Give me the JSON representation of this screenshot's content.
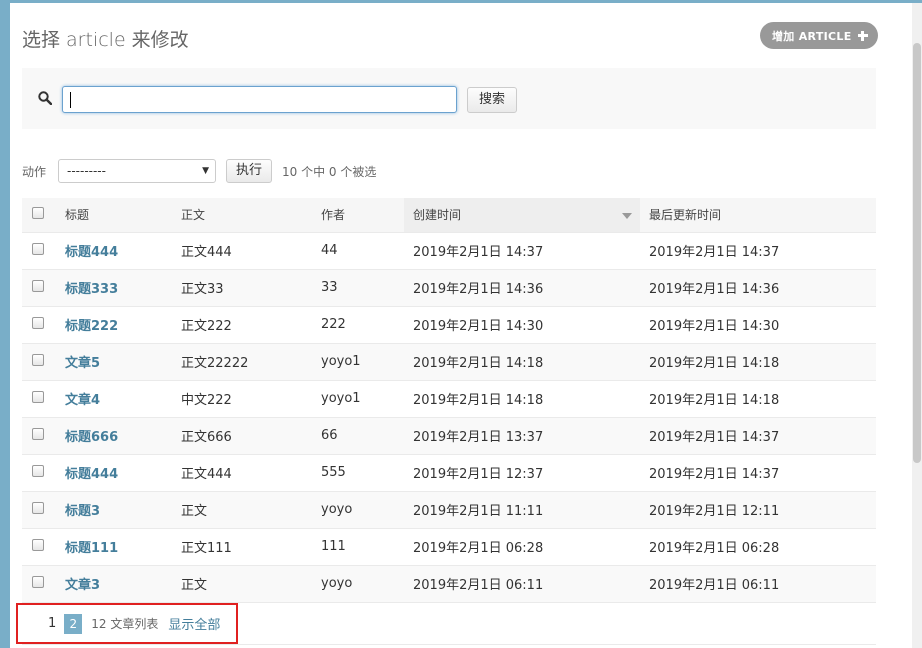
{
  "header": {
    "title": "选择 article 来修改",
    "add_button_label": "增加 ARTICLE"
  },
  "search": {
    "value": "",
    "button_label": "搜索"
  },
  "actions": {
    "label": "动作",
    "selected": "---------",
    "go_label": "执行",
    "selection_count": "10 个中 0 个被选"
  },
  "table": {
    "columns": [
      "标题",
      "正文",
      "作者",
      "创建时间",
      "最后更新时间"
    ],
    "sorted_column": "创建时间",
    "rows": [
      {
        "title": "标题444",
        "body": "正文444",
        "author": "44",
        "created": "2019年2月1日 14:37",
        "updated": "2019年2月1日 14:37"
      },
      {
        "title": "标题333",
        "body": "正文33",
        "author": "33",
        "created": "2019年2月1日 14:36",
        "updated": "2019年2月1日 14:36"
      },
      {
        "title": "标题222",
        "body": "正文222",
        "author": "222",
        "created": "2019年2月1日 14:30",
        "updated": "2019年2月1日 14:30"
      },
      {
        "title": "文章5",
        "body": "正文22222",
        "author": "yoyo1",
        "created": "2019年2月1日 14:18",
        "updated": "2019年2月1日 14:18"
      },
      {
        "title": "文章4",
        "body": "中文222",
        "author": "yoyo1",
        "created": "2019年2月1日 14:18",
        "updated": "2019年2月1日 14:18"
      },
      {
        "title": "标题666",
        "body": "正文666",
        "author": "66",
        "created": "2019年2月1日 13:37",
        "updated": "2019年2月1日 14:37"
      },
      {
        "title": "标题444",
        "body": "正文444",
        "author": "555",
        "created": "2019年2月1日 12:37",
        "updated": "2019年2月1日 14:37"
      },
      {
        "title": "标题3",
        "body": "正文",
        "author": "yoyo",
        "created": "2019年2月1日 11:11",
        "updated": "2019年2月1日 12:11"
      },
      {
        "title": "标题111",
        "body": "正文111",
        "author": "111",
        "created": "2019年2月1日 06:28",
        "updated": "2019年2月1日 06:28"
      },
      {
        "title": "文章3",
        "body": "正文",
        "author": "yoyo",
        "created": "2019年2月1日 06:11",
        "updated": "2019年2月1日 06:11"
      }
    ]
  },
  "paginator": {
    "pages": [
      "1",
      "2"
    ],
    "current_page": "2",
    "total": "12 文章列表",
    "show_all": "显示全部"
  },
  "colors": {
    "accent": "#79aec8",
    "link": "#447e9b",
    "highlight_box": "#e02020"
  }
}
